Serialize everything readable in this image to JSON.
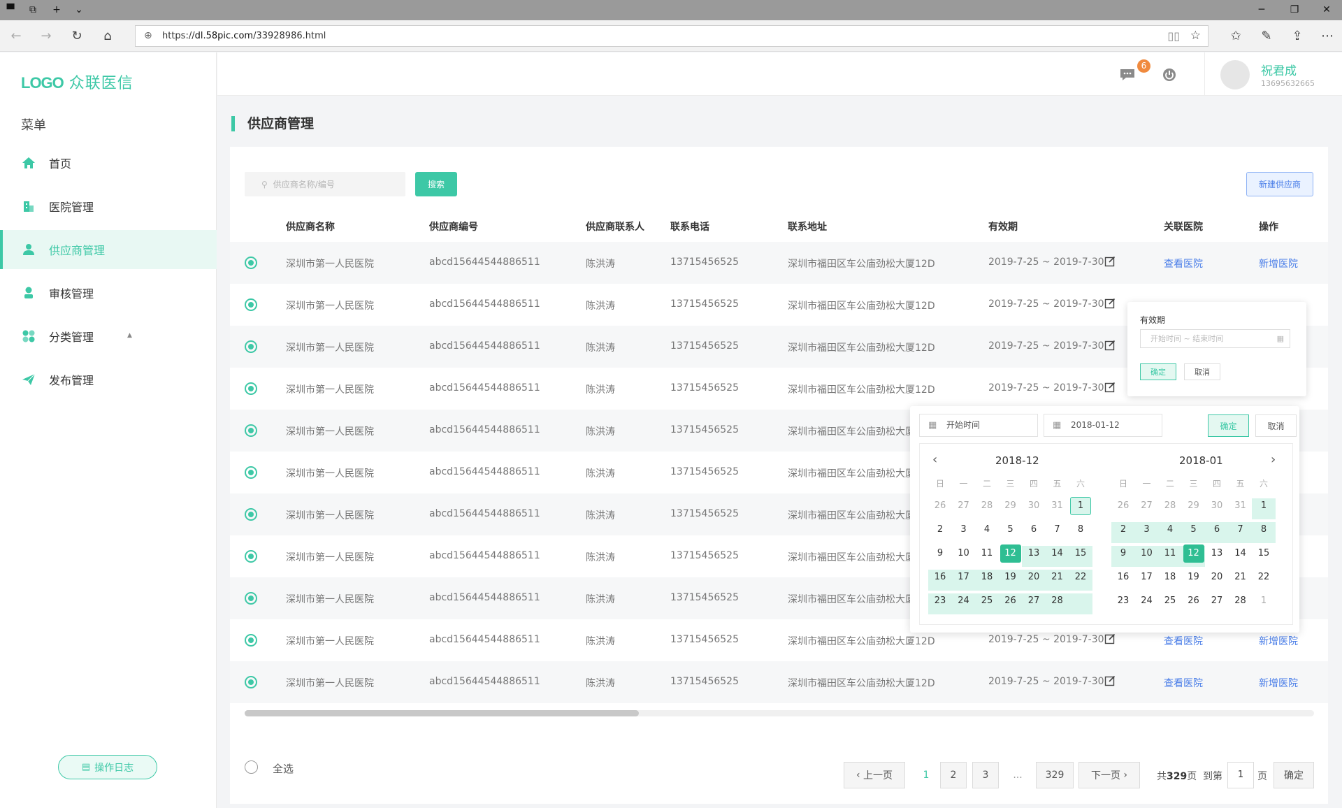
{
  "browser": {
    "url_prefix": "https://",
    "url_domain": "dl.58pic.com",
    "url_path": "/33928986.html"
  },
  "sidebar": {
    "logo_mark": "LOGO",
    "logo_text": "众联医信",
    "menu_title": "菜单",
    "items": [
      {
        "label": "首页",
        "icon": "home-icon"
      },
      {
        "label": "医院管理",
        "icon": "hospital-icon"
      },
      {
        "label": "供应商管理",
        "icon": "supplier-icon",
        "active": true
      },
      {
        "label": "审核管理",
        "icon": "audit-icon"
      },
      {
        "label": "分类管理",
        "icon": "category-icon"
      },
      {
        "label": "发布管理",
        "icon": "publish-icon"
      }
    ],
    "oplog_label": "操作日志"
  },
  "header": {
    "badge_count": "6",
    "user_name": "祝君成",
    "user_phone": "13695632665"
  },
  "page": {
    "title": "供应商管理",
    "search_placeholder": "供应商名称/编号",
    "search_button": "搜索",
    "new_button": "新建供应商"
  },
  "table": {
    "columns": [
      "供应商名称",
      "供应商编号",
      "供应商联系人",
      "联系电话",
      "联系地址",
      "有效期",
      "关联医院",
      "操作"
    ],
    "rows": [
      {
        "name": "深圳市第一人民医院",
        "code": "abcd15644544886511",
        "contact": "陈洪涛",
        "phone": "13715456525",
        "address": "深圳市福田区车公庙劲松大厦12D",
        "validity": "2019-7-25 ~ 2019-7-30",
        "view": "查看医院",
        "add": "新增医院"
      },
      {
        "name": "深圳市第一人民医院",
        "code": "abcd15644544886511",
        "contact": "陈洪涛",
        "phone": "13715456525",
        "address": "深圳市福田区车公庙劲松大厦12D",
        "validity": "2019-7-25 ~ 2019-7-30",
        "view": "",
        "add": ""
      },
      {
        "name": "深圳市第一人民医院",
        "code": "abcd15644544886511",
        "contact": "陈洪涛",
        "phone": "13715456525",
        "address": "深圳市福田区车公庙劲松大厦12D",
        "validity": "2019-7-25 ~ 2019-7-30",
        "view": "",
        "add": ""
      },
      {
        "name": "深圳市第一人民医院",
        "code": "abcd15644544886511",
        "contact": "陈洪涛",
        "phone": "13715456525",
        "address": "深圳市福田区车公庙劲松大厦12D",
        "validity": "2019-7-25 ~ 2019-7-30",
        "view": "",
        "add": ""
      },
      {
        "name": "深圳市第一人民医院",
        "code": "abcd15644544886511",
        "contact": "陈洪涛",
        "phone": "13715456525",
        "address": "深圳市福田区车公庙劲松大厦12D",
        "validity": "",
        "view": "",
        "add": ""
      },
      {
        "name": "深圳市第一人民医院",
        "code": "abcd15644544886511",
        "contact": "陈洪涛",
        "phone": "13715456525",
        "address": "深圳市福田区车公庙劲松大厦12D",
        "validity": "",
        "view": "",
        "add": ""
      },
      {
        "name": "深圳市第一人民医院",
        "code": "abcd15644544886511",
        "contact": "陈洪涛",
        "phone": "13715456525",
        "address": "深圳市福田区车公庙劲松大厦12D",
        "validity": "",
        "view": "",
        "add": ""
      },
      {
        "name": "深圳市第一人民医院",
        "code": "abcd15644544886511",
        "contact": "陈洪涛",
        "phone": "13715456525",
        "address": "深圳市福田区车公庙劲松大厦12D",
        "validity": "",
        "view": "",
        "add": ""
      },
      {
        "name": "深圳市第一人民医院",
        "code": "abcd15644544886511",
        "contact": "陈洪涛",
        "phone": "13715456525",
        "address": "深圳市福田区车公庙劲松大厦12D",
        "validity": "",
        "view": "",
        "add": ""
      },
      {
        "name": "深圳市第一人民医院",
        "code": "abcd15644544886511",
        "contact": "陈洪涛",
        "phone": "13715456525",
        "address": "深圳市福田区车公庙劲松大厦12D",
        "validity": "2019-7-25 ~ 2019-7-30",
        "view": "查看医院",
        "add": "新增医院"
      },
      {
        "name": "深圳市第一人民医院",
        "code": "abcd15644544886511",
        "contact": "陈洪涛",
        "phone": "13715456525",
        "address": "深圳市福田区车公庙劲松大厦12D",
        "validity": "2019-7-25 ~ 2019-7-30",
        "view": "查看医院",
        "add": "新增医院"
      }
    ]
  },
  "footer": {
    "select_all": "全选",
    "prev": "上一页",
    "next": "下一页",
    "pages": [
      "1",
      "2",
      "3"
    ],
    "ellipsis": "...",
    "last_page": "329",
    "total_prefix": "共",
    "total_pages": "329",
    "total_suffix": "页",
    "goto_label": "到第",
    "goto_value": "1",
    "goto_suffix": "页",
    "confirm": "确定"
  },
  "validity_popover": {
    "title": "有效期",
    "placeholder": "开始时间 ~ 结束时间",
    "ok": "确定",
    "cancel": "取消"
  },
  "datepicker": {
    "start_placeholder": "开始时间",
    "end_value": "2018-01-12",
    "ok": "确定",
    "cancel": "取消",
    "weekdays": [
      "日",
      "一",
      "二",
      "三",
      "四",
      "五",
      "六"
    ],
    "left_month": "2018-12",
    "right_month": "2018-01",
    "left_days": [
      "26",
      "27",
      "28",
      "29",
      "30",
      "31",
      "1",
      "2",
      "3",
      "4",
      "5",
      "6",
      "7",
      "8",
      "9",
      "10",
      "11",
      "12",
      "13",
      "14",
      "15",
      "16",
      "17",
      "18",
      "19",
      "20",
      "21",
      "22",
      "23",
      "24",
      "25",
      "26",
      "27",
      "28"
    ],
    "right_days": [
      "26",
      "27",
      "28",
      "29",
      "30",
      "31",
      "1",
      "2",
      "3",
      "4",
      "5",
      "6",
      "7",
      "8",
      "9",
      "10",
      "11",
      "12",
      "13",
      "14",
      "15",
      "16",
      "17",
      "18",
      "19",
      "20",
      "21",
      "22",
      "23",
      "24",
      "25",
      "26",
      "27",
      "28",
      "1"
    ]
  },
  "colors": {
    "accent": "#3dc8a6",
    "link": "#4a7ee8",
    "badge": "#f08a3e"
  }
}
